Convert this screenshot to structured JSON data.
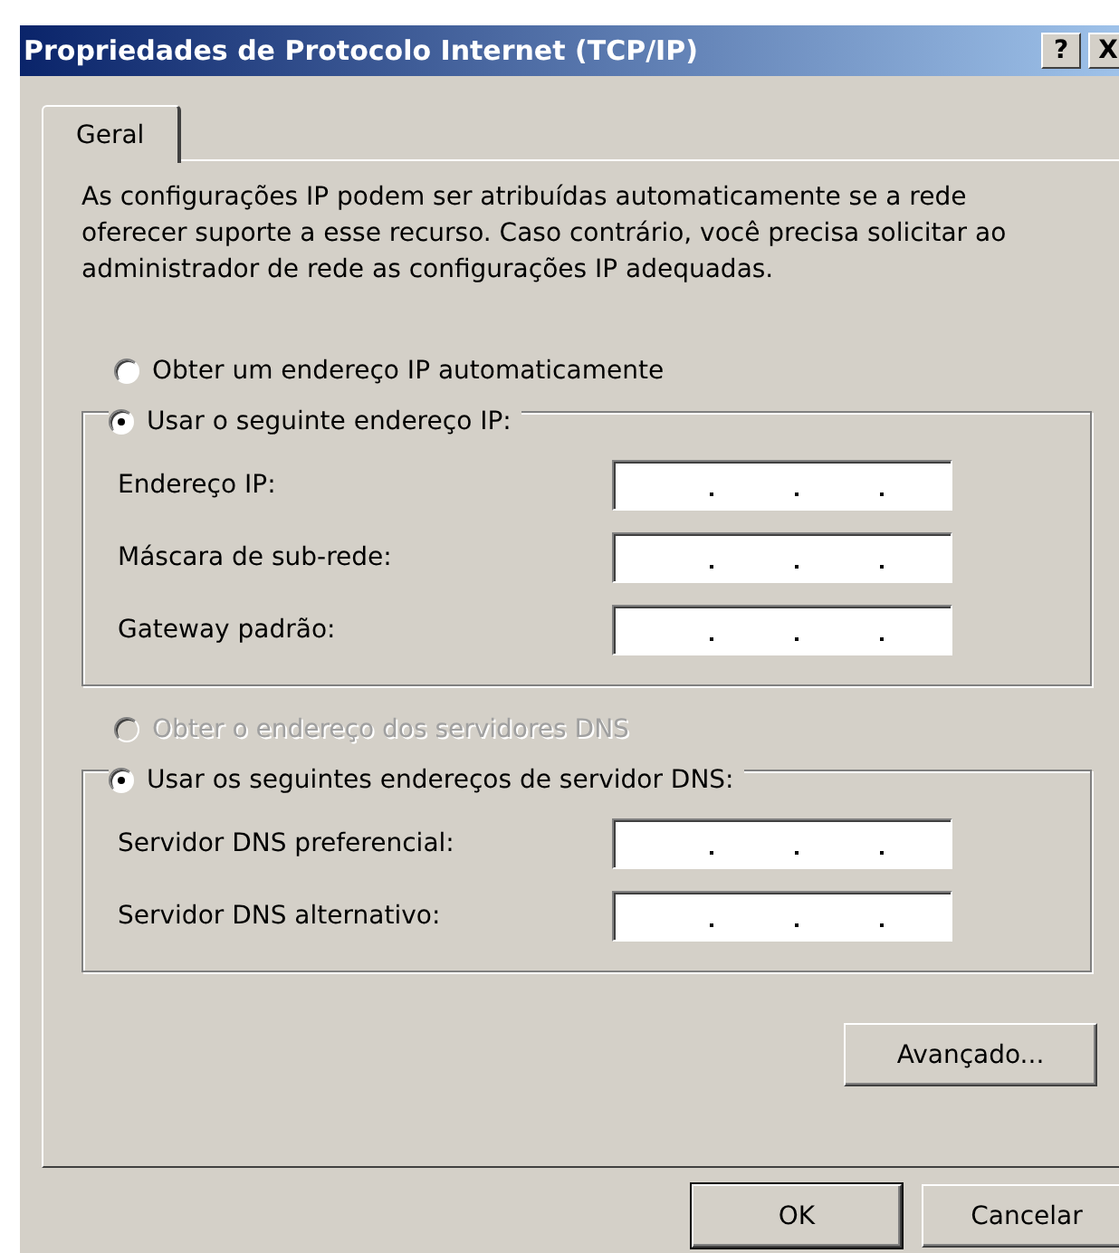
{
  "window": {
    "title": "Propriedades de Protocolo Internet (TCP/IP)",
    "buttons": [
      "?",
      "X"
    ]
  },
  "tabs": [
    {
      "label": "Geral",
      "selected": true
    }
  ],
  "description": "As configurações IP podem ser atribuídas automaticamente se a rede oferecer suporte a esse recurso. Caso contrário, você precisa solicitar ao administrador de rede as configurações IP adequadas.",
  "ip_options": [
    {
      "label": "Obter um endereço IP automaticamente",
      "selected": false,
      "disabled": false
    },
    {
      "label": "Usar o seguinte endereço IP:",
      "selected": true,
      "disabled": false
    }
  ],
  "ip_fields": [
    {
      "label": "Endereço IP:"
    },
    {
      "label": "Máscara de sub-rede:"
    },
    {
      "label": "Gateway padrão:"
    }
  ],
  "dns_options": [
    {
      "label": "Obter o endereço dos servidores DNS",
      "selected": false,
      "disabled": true
    },
    {
      "label": "Usar os seguintes endereços de servidor DNS:",
      "selected": true,
      "disabled": false
    }
  ],
  "dns_fields": [
    {
      "label": "Servidor DNS preferencial:"
    },
    {
      "label": "Servidor DNS alternativo:"
    }
  ],
  "advanced_button": "Avançado...",
  "buttons": [
    {
      "label": "OK",
      "default": true
    },
    {
      "label": "Cancelar",
      "default": false
    }
  ]
}
